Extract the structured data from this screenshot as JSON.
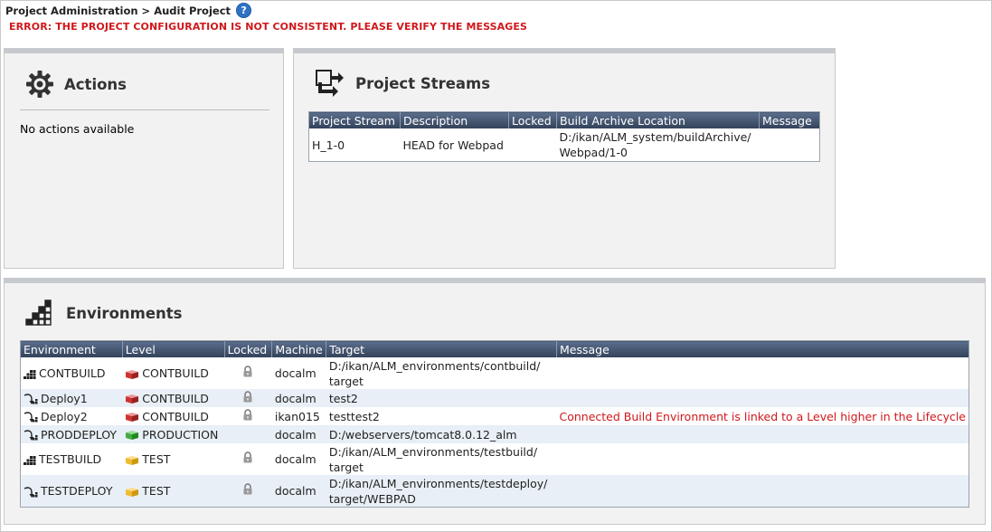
{
  "breadcrumb": {
    "text": "Project Administration > Audit Project",
    "help_icon": "help-icon"
  },
  "error": "ERROR: THE PROJECT CONFIGURATION IS NOT CONSISTENT. PLEASE VERIFY THE MESSAGES",
  "actions": {
    "title": "Actions",
    "icon": "gear-icon",
    "empty_text": "No actions available"
  },
  "streams": {
    "title": "Project Streams",
    "icon": "project-streams-icon",
    "columns": [
      "Project Stream",
      "Description",
      "Locked",
      "Build Archive Location",
      "Message"
    ],
    "rows": [
      {
        "stream": "H_1-0",
        "description": "HEAD for Webpad",
        "locked": "",
        "location_line1": "D:/ikan/ALM_system/buildArchive/",
        "location_line2": "Webpad/1-0",
        "message": ""
      }
    ]
  },
  "environments": {
    "title": "Environments",
    "icon": "environments-stairs-icon",
    "columns": [
      "Environment",
      "Level",
      "Locked",
      "Machine",
      "Target",
      "Message"
    ],
    "rows": [
      {
        "env": "CONTBUILD",
        "env_icon": "build-environment-icon",
        "level": "CONTBUILD",
        "level_icon": "level-red-icon",
        "machine": "docalm",
        "target_line1": "D:/ikan/ALM_environments/contbuild/",
        "target_line2": "target",
        "message": ""
      },
      {
        "env": "Deploy1",
        "env_icon": "deploy-environment-icon",
        "level": "CONTBUILD",
        "level_icon": "level-red-icon",
        "machine": "docalm",
        "target_line1": "test2",
        "target_line2": "",
        "message": ""
      },
      {
        "env": "Deploy2",
        "env_icon": "deploy-environment-icon",
        "level": "CONTBUILD",
        "level_icon": "level-red-icon",
        "machine": "ikan015",
        "target_line1": "testtest2",
        "target_line2": "",
        "message": "Connected Build Environment is linked to a Level higher in the Lifecycle"
      },
      {
        "env": "PRODDEPLOY",
        "env_icon": "deploy-environment-icon",
        "level": "PRODUCTION",
        "level_icon": "level-green-icon",
        "machine": "docalm",
        "target_line1": "D:/webservers/tomcat8.0.12_alm",
        "target_line2": "",
        "message": ""
      },
      {
        "env": "TESTBUILD",
        "env_icon": "build-environment-icon",
        "level": "TEST",
        "level_icon": "level-yellow-icon",
        "machine": "docalm",
        "target_line1": "D:/ikan/ALM_environments/testbuild/",
        "target_line2": "target",
        "message": ""
      },
      {
        "env": "TESTDEPLOY",
        "env_icon": "deploy-environment-icon",
        "level": "TEST",
        "level_icon": "level-yellow-icon",
        "machine": "docalm",
        "target_line1": "D:/ikan/ALM_environments/testdeploy/",
        "target_line2": "target/WEBPAD",
        "message": ""
      }
    ]
  },
  "colors": {
    "error": "#d0181b",
    "header_top": "#5b6e8c",
    "header_bottom": "#33425a",
    "row_alt": "#e8eff6",
    "panel_bg": "#f2f2f2"
  }
}
